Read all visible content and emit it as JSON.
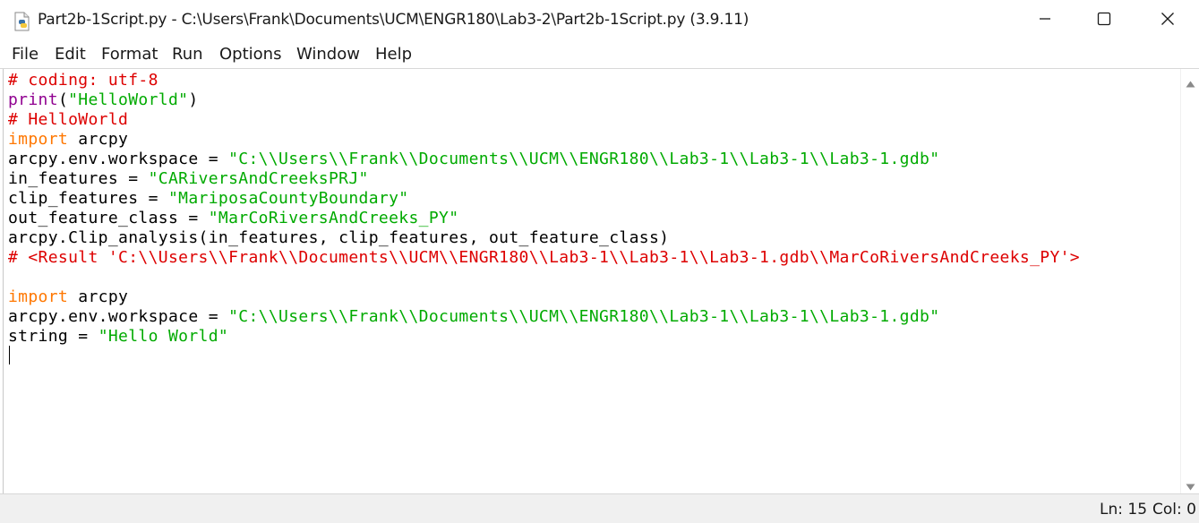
{
  "window": {
    "title": "Part2b-1Script.py - C:\\Users\\Frank\\Documents\\UCM\\ENGR180\\Lab3-2\\Part2b-1Script.py (3.9.11)",
    "icon": "python-file-icon",
    "controls": [
      "minimize-icon",
      "maximize-icon",
      "close-icon"
    ]
  },
  "menu": {
    "items": [
      {
        "label": "File"
      },
      {
        "label": "Edit"
      },
      {
        "label": "Format"
      },
      {
        "label": "Run"
      },
      {
        "label": "Options"
      },
      {
        "label": "Window"
      },
      {
        "label": "Help"
      }
    ]
  },
  "editor": {
    "lines": [
      [
        {
          "t": "# coding: utf-8",
          "c": "comment"
        }
      ],
      [
        {
          "t": "print",
          "c": "builtin"
        },
        {
          "t": "(",
          "c": "plain"
        },
        {
          "t": "\"HelloWorld\"",
          "c": "str"
        },
        {
          "t": ")",
          "c": "plain"
        }
      ],
      [
        {
          "t": "# HelloWorld",
          "c": "comment"
        }
      ],
      [
        {
          "t": "import",
          "c": "kw"
        },
        {
          "t": " arcpy",
          "c": "plain"
        }
      ],
      [
        {
          "t": "arcpy.env.workspace = ",
          "c": "plain"
        },
        {
          "t": "\"C:\\\\Users\\\\Frank\\\\Documents\\\\UCM\\\\ENGR180\\\\Lab3-1\\\\Lab3-1\\\\Lab3-1.gdb\"",
          "c": "str"
        }
      ],
      [
        {
          "t": "in_features = ",
          "c": "plain"
        },
        {
          "t": "\"CARiversAndCreeksPRJ\"",
          "c": "str"
        }
      ],
      [
        {
          "t": "clip_features = ",
          "c": "plain"
        },
        {
          "t": "\"MariposaCountyBoundary\"",
          "c": "str"
        }
      ],
      [
        {
          "t": "out_feature_class = ",
          "c": "plain"
        },
        {
          "t": "\"MarCoRiversAndCreeks_PY\"",
          "c": "str"
        }
      ],
      [
        {
          "t": "arcpy.Clip_analysis(in_features, clip_features, out_feature_class)",
          "c": "plain"
        }
      ],
      [
        {
          "t": "# <Result 'C:\\\\Users\\\\Frank\\\\Documents\\\\UCM\\\\ENGR180\\\\Lab3-1\\\\Lab3-1\\\\Lab3-1.gdb\\\\MarCoRiversAndCreeks_PY'>",
          "c": "comment"
        }
      ],
      [],
      [
        {
          "t": "import",
          "c": "kw"
        },
        {
          "t": " arcpy",
          "c": "plain"
        }
      ],
      [
        {
          "t": "arcpy.env.workspace = ",
          "c": "plain"
        },
        {
          "t": "\"C:\\\\Users\\\\Frank\\\\Documents\\\\UCM\\\\ENGR180\\\\Lab3-1\\\\Lab3-1\\\\Lab3-1.gdb\"",
          "c": "str"
        }
      ],
      [
        {
          "t": "string = ",
          "c": "plain"
        },
        {
          "t": "\"Hello World\"",
          "c": "str"
        }
      ],
      []
    ]
  },
  "status": {
    "line": "Ln: 15",
    "col": "Col: 0"
  },
  "colors": {
    "comment": "#dd0000",
    "keyword": "#ff7700",
    "builtin": "#900090",
    "string": "#00aa00"
  }
}
